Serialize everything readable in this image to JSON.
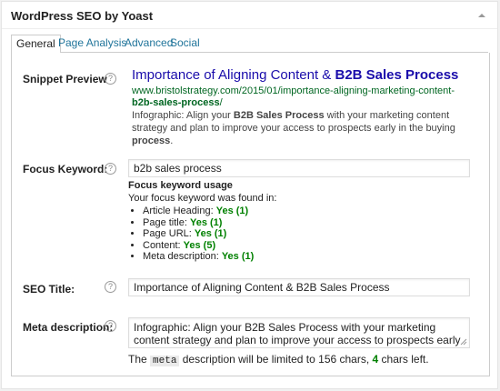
{
  "metabox": {
    "title": "WordPress SEO by Yoast"
  },
  "tabs": [
    "General",
    "Page Analysis",
    "Advanced",
    "Social"
  ],
  "labels": {
    "snippet": "Snippet Preview",
    "focus": "Focus Keyword:",
    "seo_title": "SEO Title:",
    "meta_desc": "Meta description:"
  },
  "help_glyph": "?",
  "snippet": {
    "title_pre": "Importance of Aligning Content & ",
    "title_bold": "B2B Sales Process",
    "url_pre": "www.bristolstrategy.com/2015/01/importance-aligning-marketing-content-",
    "url_bold": "b2b-sales-process",
    "url_post": "/",
    "desc_1": "Infographic: Align your ",
    "desc_bold1": "B2B Sales Process",
    "desc_2": " with your marketing content strategy and plan to improve your access to prospects early in the buying ",
    "desc_bold2": "process",
    "desc_3": "."
  },
  "focus_keyword": "b2b sales process",
  "usage": {
    "heading": "Focus keyword usage",
    "found": "Your focus keyword was found in:",
    "items": [
      {
        "label": "Article Heading: ",
        "value": "Yes (1)"
      },
      {
        "label": "Page title: ",
        "value": "Yes (1)"
      },
      {
        "label": "Page URL: ",
        "value": "Yes (1)"
      },
      {
        "label": "Content: ",
        "value": "Yes (5)"
      },
      {
        "label": "Meta description: ",
        "value": "Yes (1)"
      }
    ]
  },
  "seo_title": "Importance of Aligning Content & B2B Sales Process",
  "meta_description": "Infographic: Align your B2B Sales Process with your marketing content strategy and plan to improve your access to prospects early in the buying process.",
  "limit": {
    "pre": "The ",
    "code": "meta",
    "mid": " description will be limited to 156 chars, ",
    "count": "4",
    "post": " chars left."
  }
}
